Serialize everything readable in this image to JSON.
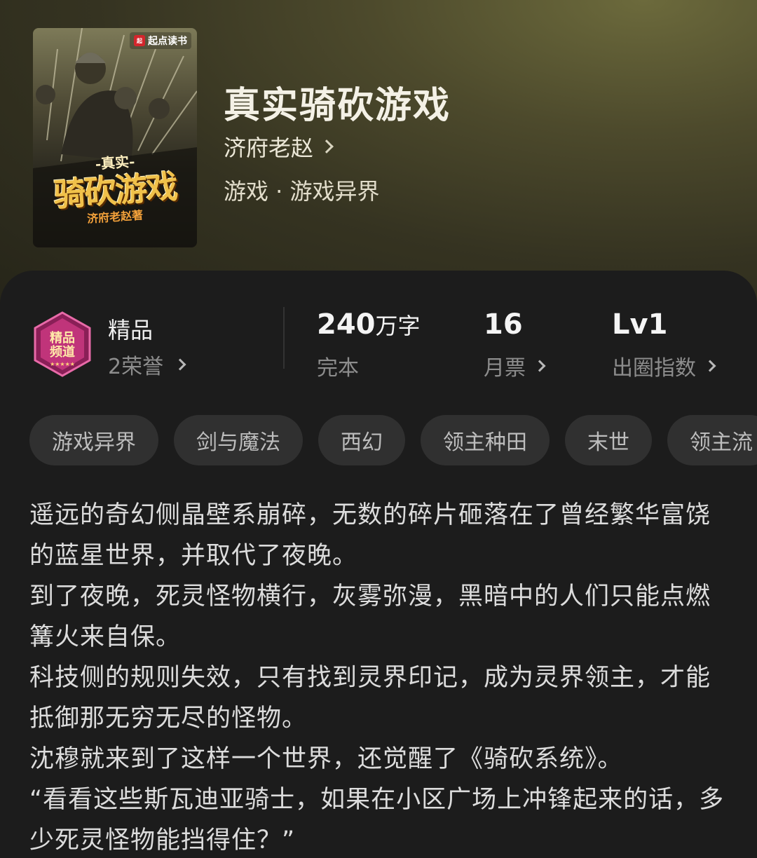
{
  "book": {
    "cover_brand": "起点读书",
    "cover_title_top": "-真实-",
    "cover_title_main": "骑砍游戏",
    "cover_author": "济府老赵著",
    "title": "真实骑砍游戏",
    "author": "济府老赵",
    "genre": "游戏 · 游戏异界"
  },
  "stats": {
    "badge_label": "精品",
    "honor": "2荣誉",
    "words_value": "240",
    "words_unit": "万字",
    "status": "完本",
    "monthly_votes_value": "16",
    "monthly_votes_label": "月票",
    "level_value": "Lv1",
    "level_label": "出圈指数"
  },
  "tags": [
    "游戏异界",
    "剑与魔法",
    "西幻",
    "领主种田",
    "末世",
    "领主流"
  ],
  "synopsis": [
    "遥远的奇幻侧晶壁系崩碎，无数的碎片砸落在了曾经繁华富饶的蓝星世界，并取代了夜晚。",
    "到了夜晚，死灵怪物横行，灰雾弥漫，黑暗中的人们只能点燃篝火来自保。",
    "科技侧的规则失效，只有找到灵界印记，成为灵界领主，才能抵御那无穷无尽的怪物。",
    "沈穆就来到了这样一个世界，还觉醒了《骑砍系统》。",
    "“看看这些斯瓦迪亚骑士，如果在小区广场上冲锋起来的话，多少死灵怪物能挡得住？”"
  ],
  "colors": {
    "accent_gold": "#f0c14a",
    "card_bg": "#1c1c1c",
    "tag_bg": "#303030",
    "badge_pink": "#c0347a"
  },
  "icons": {
    "badge": "premium-channel-badge-icon",
    "chevron": "chevron-right-icon"
  }
}
